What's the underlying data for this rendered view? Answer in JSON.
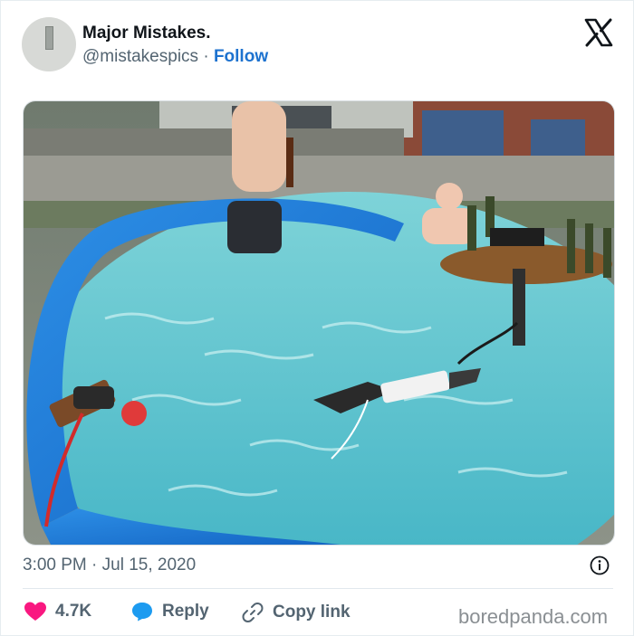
{
  "tweet": {
    "author_name": "Major Mistakes.",
    "handle": "@mistakespics",
    "separator": "·",
    "follow_label": "Follow",
    "timestamp": "3:00 PM · Jul 15, 2020",
    "likes": "4.7K",
    "reply_label": "Reply",
    "copy_link_label": "Copy link"
  },
  "watermark": "boredpanda.com",
  "colors": {
    "follow": "#1d72cf",
    "like_heart": "#f91880",
    "reply_bubble": "#1d9bf0",
    "pool_wall": "#1f7fd9",
    "water": "#58c2cf"
  },
  "icons": {
    "logo": "x-logo-icon",
    "like": "heart-icon",
    "reply": "speech-bubble-icon",
    "copy": "link-icon",
    "info": "info-icon"
  }
}
